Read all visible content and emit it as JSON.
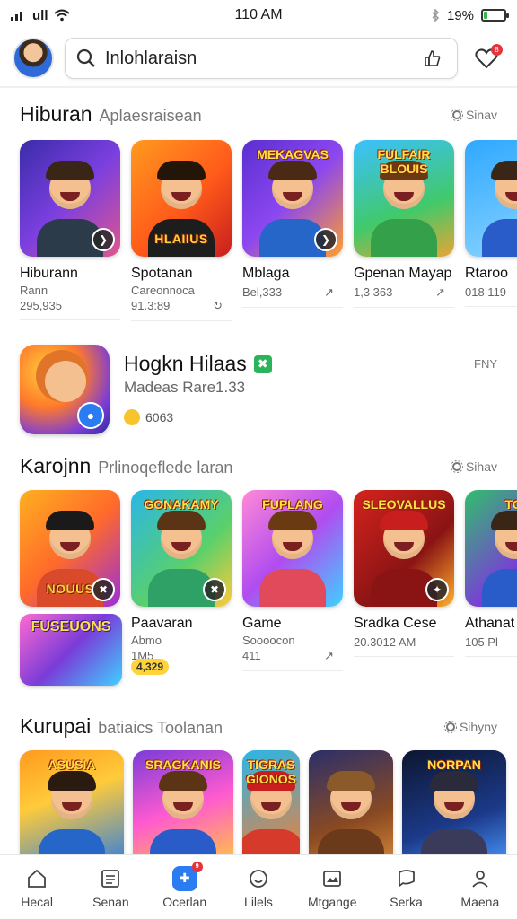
{
  "status_bar": {
    "time": "110 AM",
    "signal": "ull",
    "battery": "19%",
    "battery_level": 0.19,
    "battery_color": "#35b64a"
  },
  "header": {
    "search_value": "Inlohlaraisn"
  },
  "section1": {
    "title": "Hiburan",
    "subtitle": "Aplaesraisean",
    "more": "Sinav",
    "cards": [
      {
        "title": "Hiburann",
        "sub": "Rann",
        "meta": "295,935",
        "meta2": "",
        "bg": "linear-gradient(135deg,#3a2ca8,#7b3fe0 50%,#e0568c)",
        "hair": "#3a2616",
        "shirt": "#2c3b4a",
        "banner": "",
        "topbanner": "",
        "badge": "❯"
      },
      {
        "title": "Spotanan",
        "sub": "Careonnoca",
        "meta": "91.3:89",
        "meta2": "↻",
        "bg": "linear-gradient(135deg,#ff9a1f,#ff5a1a 55%,#c81e1e)",
        "hair": "#241509",
        "shirt": "#1d1d1d",
        "banner": "HLAIIUS",
        "topbanner": "",
        "badge": ""
      },
      {
        "title": "Mblaga",
        "sub": "",
        "meta": "Bel,333",
        "meta2": "↗",
        "bg": "linear-gradient(135deg,#5a2fd0,#8c47f0 50%,#ff9e2b)",
        "hair": "#4a2a14",
        "shirt": "#2566c8",
        "banner": "",
        "topbanner": "MEKAGVAS",
        "badge": "❯"
      },
      {
        "title": "Gpenan Mayap",
        "sub": "",
        "meta": "1,3 363",
        "meta2": "↗",
        "bg": "linear-gradient(160deg,#3cc0ff,#41c96a 60%,#e8a534)",
        "hair": "#6b3a12",
        "shirt": "#35a04a",
        "banner": "",
        "topbanner": "FULFAIR BLOUIS",
        "badge": ""
      },
      {
        "title": "Rtaroo",
        "sub": "",
        "meta": "018 119",
        "meta2": "",
        "bg": "linear-gradient(160deg,#2fa8ff,#8fd6ff)",
        "hair": "#3a2616",
        "shirt": "#2a5cc9",
        "banner": "",
        "topbanner": "",
        "badge": ""
      }
    ]
  },
  "featured": {
    "title": "Hogkn Hilaas",
    "sub": "Madeas Rare1.33",
    "rating": "6063",
    "more": "FNY"
  },
  "section2": {
    "title": "Karojnn",
    "subtitle": "Prlinoqeflede laran",
    "more": "Sihav",
    "cards": [
      {
        "title": "",
        "sub": "",
        "meta": "",
        "meta2": "",
        "bg": "linear-gradient(135deg,#ffb020,#ff6a2a 50%,#9a2fd8)",
        "hair": "#1a1a1a",
        "shirt": "#d94a2a",
        "banner": "NOUUS",
        "topbanner": "",
        "badge": "✖"
      },
      {
        "title": "Paavaran",
        "sub": "Abmo",
        "meta": "1M5",
        "meta2": "",
        "bg": "linear-gradient(135deg,#29b6e8,#5ad06a 60%,#ffca3a)",
        "hair": "#5a3414",
        "shirt": "#2fa066",
        "banner": "",
        "topbanner": "GONAKAMY",
        "badge": "✖"
      },
      {
        "title": "Game",
        "sub": "Soooocon",
        "meta": "411",
        "meta2": "↗",
        "bg": "linear-gradient(135deg,#ff8ad6,#b14cf0 50%,#3fd0ff)",
        "hair": "#6a3a12",
        "shirt": "#e04a5a",
        "banner": "",
        "topbanner": "FUPLANG",
        "badge": ""
      },
      {
        "title": "Sradka Cese",
        "sub": "",
        "meta": "20.3012 AM",
        "meta2": "",
        "bg": "linear-gradient(135deg,#d6231e,#8a1414 60%,#ffb02b)",
        "hair": "#c81e1e",
        "shirt": "#8a1414",
        "banner": "",
        "topbanner": "SLEOVALLUS",
        "badge": "✦"
      },
      {
        "title": "Athanat",
        "sub": "",
        "meta": "105 Pl",
        "meta2": "",
        "bg": "linear-gradient(135deg,#2fc06a,#7a3cd8 60%,#ffca3a)",
        "hair": "#3a2616",
        "shirt": "#2a5cc9",
        "banner": "",
        "topbanner": "TOI",
        "badge": ""
      }
    ],
    "extra_card": {
      "label": "FUSEUONS",
      "rating": "4,329"
    }
  },
  "section3": {
    "title": "Kurupai",
    "subtitle": "batiaics Toolanan",
    "more": "Sihyny",
    "cards": [
      {
        "topbanner": "ASUSIA",
        "bg": "linear-gradient(160deg,#ff9a1f,#ffcb3a 40%,#2f7de0)",
        "hair": "#2a1a10",
        "shirt": "#2566c8"
      },
      {
        "topbanner": "SRAGKANIS",
        "bg": "linear-gradient(160deg,#7a3cd8,#ff5ad0 50%,#ffcb3a)",
        "hair": "#5a3414",
        "shirt": "#2a5cc9"
      },
      {
        "topbanner": "TIGRAS GIONOS",
        "bg": "linear-gradient(160deg,#29b6e8,#ff7a2b)",
        "hair": "#c81e1e",
        "shirt": "#d63a2a"
      },
      {
        "topbanner": "",
        "bg": "linear-gradient(160deg,#2a2f6a,#8a4a22 60%,#d68a3a)",
        "hair": "#8a5a2a",
        "shirt": "#6a3a1a"
      },
      {
        "topbanner": "NORPAN",
        "bg": "linear-gradient(160deg,#0c1630,#1c3a8a 60%,#4a9aff)",
        "hair": "#2a2a3a",
        "shirt": "#3a3a5a"
      }
    ]
  },
  "bottom_nav": [
    {
      "label": "Hecal",
      "icon": "home-icon"
    },
    {
      "label": "Senan",
      "icon": "list-icon"
    },
    {
      "label": "Ocerlan",
      "icon": "games-icon",
      "active": true,
      "badge": "9"
    },
    {
      "label": "Lilels",
      "icon": "smile-icon"
    },
    {
      "label": "Mtgange",
      "icon": "image-icon"
    },
    {
      "label": "Serka",
      "icon": "chat-icon"
    },
    {
      "label": "Maena",
      "icon": "person-icon"
    }
  ]
}
